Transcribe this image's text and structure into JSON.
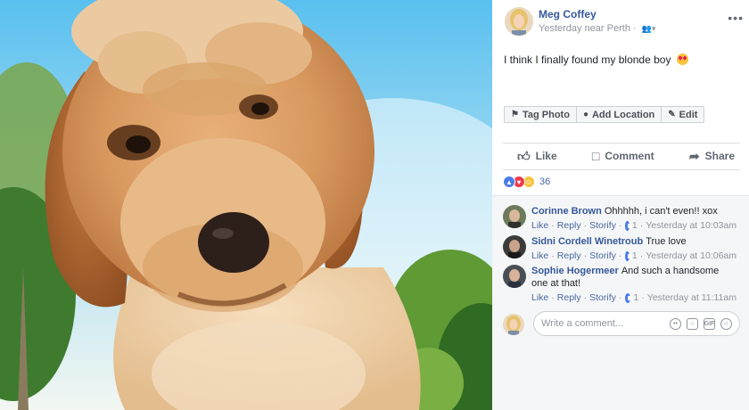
{
  "post": {
    "author": "Meg Coffey",
    "meta": "Yesterday near Perth ·",
    "audience_icon": "friends-icon",
    "text": "I think I finally found my blonde boy",
    "text_emoji": "heart-eyes-emoji"
  },
  "photo_actions": [
    {
      "label": "Tag Photo",
      "icon": "tag-icon"
    },
    {
      "label": "Add Location",
      "icon": "location-pin-icon"
    },
    {
      "label": "Edit",
      "icon": "pencil-icon"
    }
  ],
  "actions": [
    {
      "label": "Like",
      "icon": "thumbs-up-icon"
    },
    {
      "label": "Comment",
      "icon": "comment-bubble-icon"
    },
    {
      "label": "Share",
      "icon": "share-arrow-icon"
    }
  ],
  "reactions": {
    "types": [
      "like",
      "love",
      "haha"
    ],
    "count": "36"
  },
  "comments": [
    {
      "author": "Corinne Brown",
      "text": "Ohhhhh, i can't even!! xox",
      "like": "Like",
      "reply": "Reply",
      "storify": "Storify",
      "likes": "1",
      "time": "Yesterday at 10:03am"
    },
    {
      "author": "Sidni Cordell Winetroub",
      "text": "True love",
      "like": "Like",
      "reply": "Reply",
      "storify": "Storify",
      "likes": "1",
      "time": "Yesterday at 10:06am"
    },
    {
      "author": "Sophie Hogermeer",
      "text": "And such a handsome one at that!",
      "like": "Like",
      "reply": "Reply",
      "storify": "Storify",
      "likes": "1",
      "time": "Yesterday at 11:11am"
    }
  ],
  "compose": {
    "placeholder": "Write a comment...",
    "icons": [
      "emoji-icon",
      "camera-icon",
      "gif-icon",
      "sticker-icon"
    ]
  },
  "colors": {
    "link": "#365899",
    "muted": "#90949c",
    "like_blue": "#4a7ce8",
    "love_red": "#f0384b",
    "haha_yellow": "#f7c33c"
  }
}
